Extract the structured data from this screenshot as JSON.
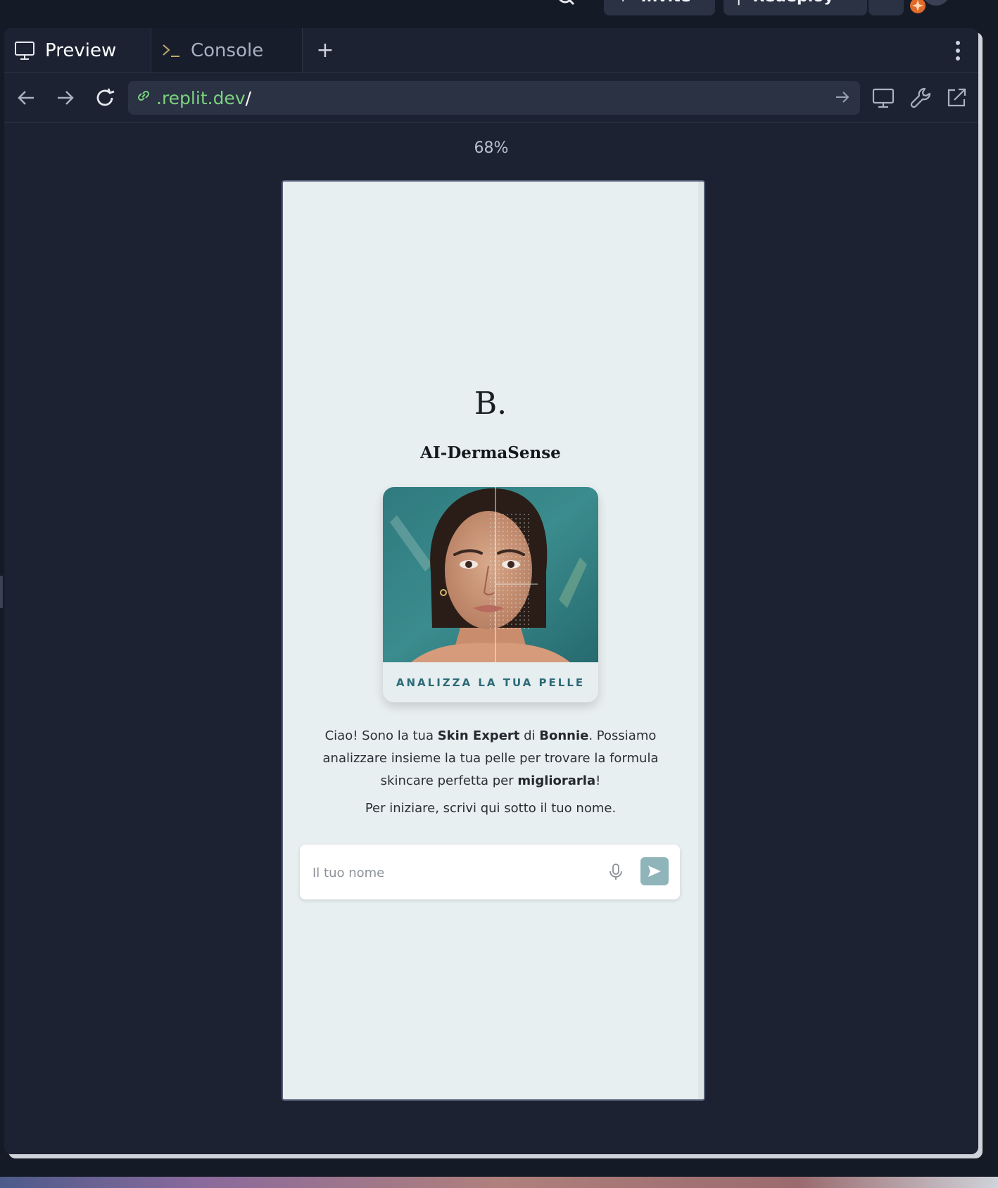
{
  "topbar": {
    "invite_label": "Invite",
    "redeploy_label": "Redeploy"
  },
  "tabs": {
    "preview_label": "Preview",
    "console_label": "Console",
    "add_label": "+"
  },
  "browser": {
    "url_host": ".replit.dev",
    "url_path": "/",
    "zoom": "68%"
  },
  "app": {
    "logo": "B.",
    "brand": "AI-DermaSense",
    "card_label": "ANALIZZA LA TUA PELLE",
    "intro": {
      "t1": "Ciao! Sono la tua ",
      "b1": "Skin Expert",
      "t2": " di ",
      "b2": "Bonnie",
      "t3": ". Possiamo analizzare insieme la tua pelle per trovare la formula skincare perfetta per ",
      "b3": "migliorarla",
      "t4": "!"
    },
    "cta": "Per iniziare, scrivi qui sotto il tuo nome.",
    "name_placeholder": "Il tuo nome",
    "name_value": ""
  },
  "icons": {
    "preview": "monitor-icon",
    "console": "terminal-icon",
    "back": "arrow-left-icon",
    "forward": "arrow-right-icon",
    "reload": "reload-icon",
    "link": "link-icon",
    "go": "arrow-right-icon",
    "devices": "monitor-icon",
    "devtools": "wrench-icon",
    "external": "external-link-icon",
    "mic": "microphone-icon",
    "send": "send-icon"
  },
  "colors": {
    "accent_teal": "#2d6b78",
    "send_button": "#8fb5bb",
    "url_host": "#7bd37f",
    "app_background": "#e8eff0"
  }
}
